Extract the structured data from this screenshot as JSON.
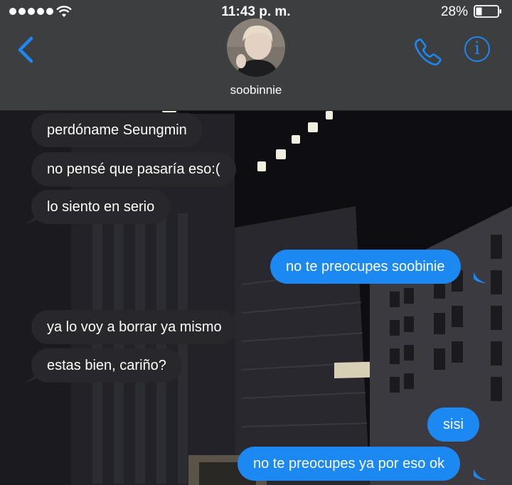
{
  "status_bar": {
    "time": "11:43 p. m.",
    "battery_percent": "28%",
    "signal_dots": 5,
    "battery_level": 0.28
  },
  "header": {
    "contact_name": "soobinnie"
  },
  "colors": {
    "accent": "#1d87f2",
    "sent_bubble": "#1c88f2",
    "received_bubble": "#27272c",
    "header_bg": "#3d3e40"
  },
  "messages": [
    {
      "from": "them",
      "text": "perdóname Seungmin"
    },
    {
      "from": "them",
      "text": "no pensé que pasaría eso:("
    },
    {
      "from": "them",
      "text": "lo siento en serio"
    },
    {
      "from": "me",
      "text": "no te preocupes soobinie"
    },
    {
      "from": "them",
      "text": "ya lo voy a borrar ya mismo"
    },
    {
      "from": "them",
      "text": "estas bien, cariño?"
    },
    {
      "from": "me",
      "text": "sisi"
    },
    {
      "from": "me",
      "text": "no te preocupes ya por eso ok"
    }
  ],
  "icons": {
    "back": "chevron-left-icon",
    "call": "phone-icon",
    "info": "info-icon"
  }
}
